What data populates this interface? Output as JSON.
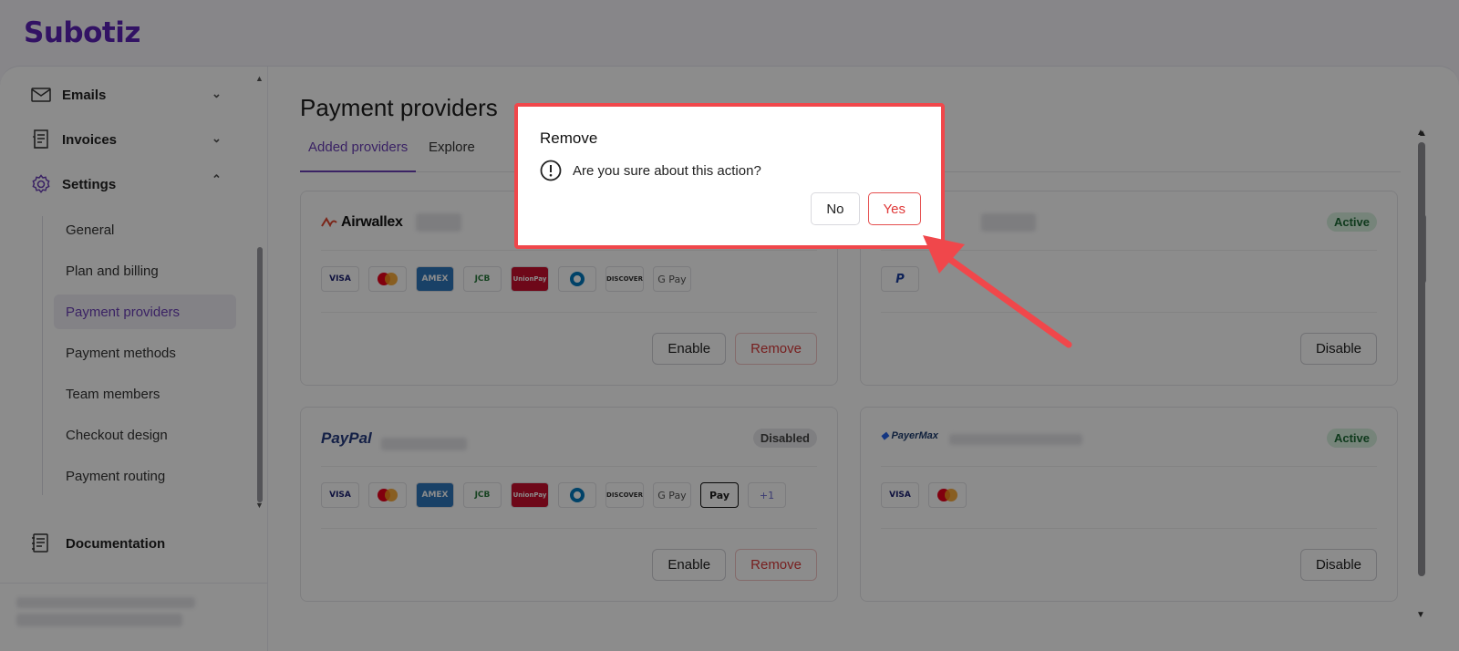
{
  "app": {
    "logo": "Subotiz"
  },
  "sidebar": {
    "items": [
      {
        "label": "Emails",
        "icon": "mail-icon",
        "chevron": "chevron-down"
      },
      {
        "label": "Invoices",
        "icon": "invoice-icon",
        "chevron": "chevron-down"
      },
      {
        "label": "Settings",
        "icon": "gear-icon",
        "chevron": "chevron-up"
      }
    ],
    "settings_subitems": [
      "General",
      "Plan and billing",
      "Payment providers",
      "Payment methods",
      "Team members",
      "Checkout design",
      "Payment routing"
    ],
    "active_subitem": "Payment providers",
    "documentation": "Documentation"
  },
  "main": {
    "title": "Payment providers",
    "tabs": [
      {
        "label": "Added providers",
        "active": true
      },
      {
        "label": "Explore",
        "active": false
      }
    ],
    "cards": [
      {
        "brand": "Airwallex",
        "status": "",
        "methods": [
          "VISA",
          "Mastercard",
          "AMEX",
          "JCB",
          "UnionPay",
          "Diners",
          "DISCOVER",
          "G Pay"
        ],
        "buttons": [
          "Enable",
          "Remove"
        ]
      },
      {
        "brand": "PayPal (P)",
        "status": "Active",
        "methods": [
          "PayPal"
        ],
        "buttons": [
          "Disable"
        ]
      },
      {
        "brand": "PayPal",
        "status": "Disabled",
        "methods": [
          "VISA",
          "Mastercard",
          "AMEX",
          "JCB",
          "UnionPay",
          "Diners",
          "DISCOVER",
          "G Pay",
          "Apple Pay",
          "+1"
        ],
        "buttons": [
          "Enable",
          "Remove"
        ]
      },
      {
        "brand": "PayerMax",
        "status": "Active",
        "methods": [
          "VISA",
          "Mastercard"
        ],
        "buttons": [
          "Disable"
        ]
      }
    ]
  },
  "modal": {
    "title": "Remove",
    "message": "Are you sure about this action?",
    "no_label": "No",
    "yes_label": "Yes",
    "highlight_color": "#f0474b"
  },
  "colors": {
    "brand": "#5b21b6",
    "accent": "#6b3fb7",
    "danger": "#d93a3a",
    "active_badge": "#d7f0de"
  }
}
